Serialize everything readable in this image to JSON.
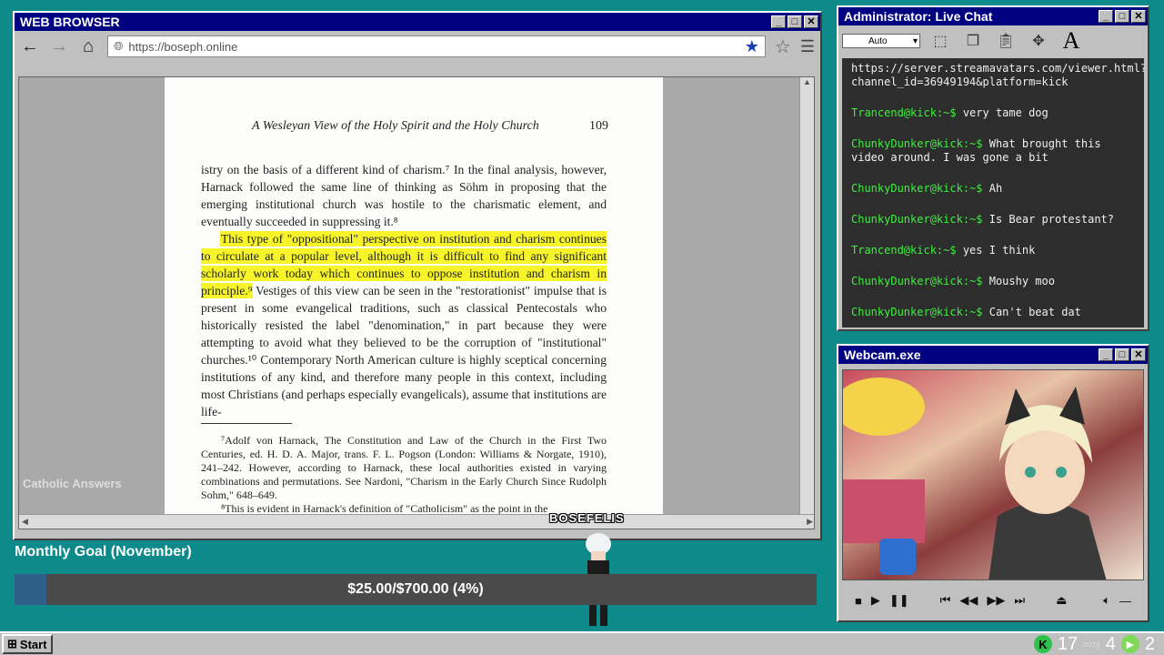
{
  "browser": {
    "title": "WEB BROWSER",
    "url": "https://boseph.online",
    "page": {
      "running_head": "A Wesleyan View of the Holy Spirit and the Holy Church",
      "page_number": "109",
      "para1": "istry on the basis of a different kind of charism.⁷ In the final analysis, however, Harnack followed the same line of thinking as Söhm in proposing that the emerging institutional church was hostile to the charismatic element, and eventually succeeded in suppressing it.⁸",
      "para2_highlight": "This type of \"oppositional\" perspective on institution and charism continues to circulate at a popular level, although it is difficult to find any significant scholarly work today which continues to oppose institution and charism in principle.⁹",
      "para2_rest": " Vestiges of this view can be seen in the \"restorationist\" impulse that is present in some evangelical traditions, such as classical Pentecostals who historically resisted the label \"denomination,\" in part because they were attempting to avoid what they believed to be the corruption of \"institutional\" churches.¹⁰ Contemporary North American culture is highly sceptical concerning institutions of any kind, and therefore many people in this context, including most Christians (and perhaps especially evangelicals), assume that institutions are life-",
      "footnote7": "⁷Adolf von Harnack, The Constitution and Law of the Church in the First Two Centuries, ed. H. D. A. Major, trans. F. L. Pogson (London: Williams & Norgate, 1910), 241–242. However, according to Harnack, these local authorities existed in varying combinations and permutations. See Nardoni, \"Charism in the Early Church Since Rudolph Sohm,\" 648–649.",
      "footnote8": "⁸This is evident in Harnack's definition of \"Catholicism\" as the point in the"
    },
    "watermark": "Catholic Answers"
  },
  "chat": {
    "title": "Administrator: Live Chat",
    "auto_label": "Auto",
    "top_line": "https://server.streamavatars.com/viewer.html?channel_id=36949194&platform=kick",
    "messages": [
      {
        "user": "Trancend@kick:~$",
        "text": "very tame dog"
      },
      {
        "user": "ChunkyDunker@kick:~$",
        "text": "What brought this video around. I was gone a bit"
      },
      {
        "user": "ChunkyDunker@kick:~$",
        "text": "Ah"
      },
      {
        "user": "ChunkyDunker@kick:~$",
        "text": "Is Bear protestant?"
      },
      {
        "user": "Trancend@kick:~$",
        "text": "yes I think"
      },
      {
        "user": "ChunkyDunker@kick:~$",
        "text": "Moushy moo"
      },
      {
        "user": "ChunkyDunker@kick:~$",
        "text": "Can't beat dat"
      }
    ]
  },
  "webcam": {
    "title": "Webcam.exe"
  },
  "goal": {
    "label": "Monthly Goal (November)",
    "text": "$25.00/$700.00 (4%)",
    "progress": 0.04
  },
  "overlay": {
    "streamer_tag": "BOSEFELIS"
  },
  "taskbar": {
    "start_label": "Start",
    "tray_count1": "17",
    "tray_label": "cozy",
    "tray_count2": "4",
    "tray_count3": "2"
  },
  "colors": {
    "accent": "#000080",
    "desktop": "#0e8a8a",
    "highlight": "#f7f52a",
    "chat_user": "#3cf03c"
  }
}
